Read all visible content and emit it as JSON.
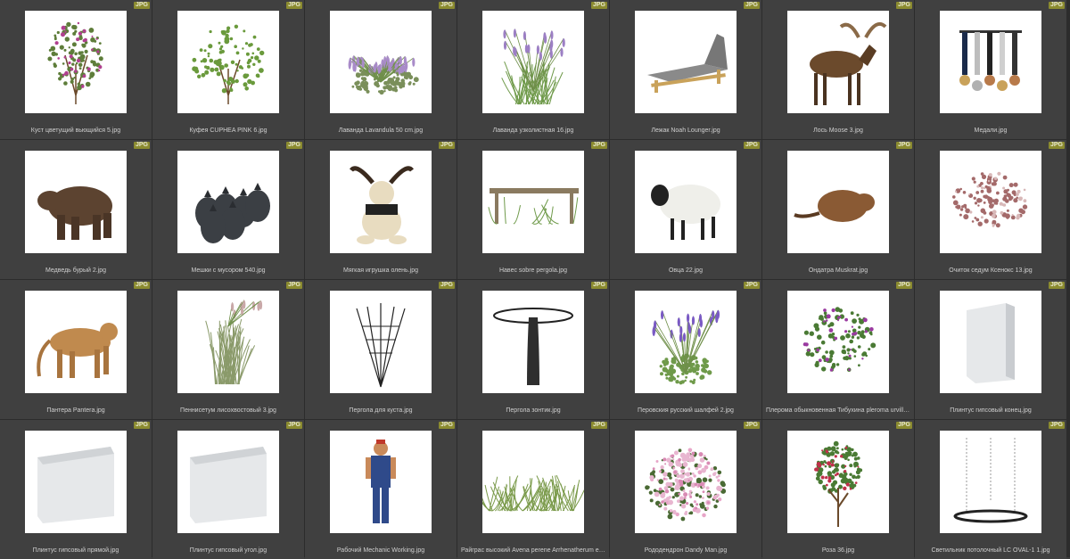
{
  "badge_label": "JPG",
  "colors": {
    "background": "#3a3a3a",
    "tile": "#404040",
    "badge": "#8b8b30",
    "caption": "#cfcfcf"
  },
  "items": [
    {
      "name": "Куст цветущий вьющийся 5.jpg",
      "icon": "flowering-shrub-icon"
    },
    {
      "name": "Куфея CUPHEA PINK 6.jpg",
      "icon": "green-bush-icon"
    },
    {
      "name": "Лаванда Lavandula 50 cm.jpg",
      "icon": "lavender-icon"
    },
    {
      "name": "Лаванда узколистная 16.jpg",
      "icon": "lavender-tall-icon"
    },
    {
      "name": "Лежак Noah Lounger.jpg",
      "icon": "lounger-icon"
    },
    {
      "name": "Лось Moose 3.jpg",
      "icon": "moose-icon"
    },
    {
      "name": "Медали.jpg",
      "icon": "medals-icon"
    },
    {
      "name": "Медведь бурый 2.jpg",
      "icon": "bear-icon"
    },
    {
      "name": "Мешки с мусором 540.jpg",
      "icon": "trash-bags-icon"
    },
    {
      "name": "Мягкая игрушка олень.jpg",
      "icon": "plush-deer-icon"
    },
    {
      "name": "Навес sobre pergola.jpg",
      "icon": "pergola-canopy-icon"
    },
    {
      "name": "Овца 22.jpg",
      "icon": "sheep-icon"
    },
    {
      "name": "Ондатра Muskrat.jpg",
      "icon": "muskrat-icon"
    },
    {
      "name": "Очиток седум Ксенокс 13.jpg",
      "icon": "sedum-icon"
    },
    {
      "name": "Пантера Pantera.jpg",
      "icon": "puma-icon"
    },
    {
      "name": "Пеннисетум лисохвостовый 3.jpg",
      "icon": "grass-plume-icon"
    },
    {
      "name": "Пергола для куста.jpg",
      "icon": "trellis-icon"
    },
    {
      "name": "Пергола зонтик.jpg",
      "icon": "umbrella-pergola-icon"
    },
    {
      "name": "Перовския русский шалфей 2.jpg",
      "icon": "perovskia-icon"
    },
    {
      "name": "Плерома обыкновенная Тибухина pleroma urvilleanum tib...",
      "icon": "pleroma-icon"
    },
    {
      "name": "Плинтус гипсовый конец.jpg",
      "icon": "plinth-end-icon"
    },
    {
      "name": "Плинтус гипсовый прямой.jpg",
      "icon": "plinth-straight-icon"
    },
    {
      "name": "Плинтус гипсовый угол.jpg",
      "icon": "plinth-corner-icon"
    },
    {
      "name": "Рабочий Mechanic Working.jpg",
      "icon": "mechanic-icon"
    },
    {
      "name": "Райграс высокий Avena perene Arrhenatherum elatius.jpg",
      "icon": "ryegrass-icon"
    },
    {
      "name": "Рододендрон Dandy Man.jpg",
      "icon": "rhododendron-icon"
    },
    {
      "name": "Роза 36.jpg",
      "icon": "rose-tree-icon"
    },
    {
      "name": "Светильник потолочный LC OVAL-1 1.jpg",
      "icon": "ceiling-lamp-icon"
    }
  ]
}
